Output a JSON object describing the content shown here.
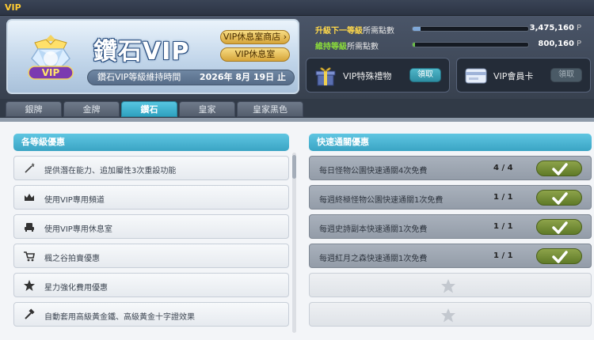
{
  "window": {
    "title": "VIP"
  },
  "vip_card": {
    "tier_name": "鑽石VIP",
    "emblem_text": "VIP",
    "shop_button": "VIP休息室商店",
    "lounge_button": "VIP休息室",
    "maintain_label": "鑽石VIP等級維持時間",
    "maintain_date": "2026年 8月 19日 止"
  },
  "progress": {
    "upgrade_key": "升級下一等級",
    "upgrade_rest": "所需點數",
    "upgrade_value": "3,475,160",
    "upgrade_fill_pct": 7,
    "maintain_key": "維持等級",
    "maintain_rest": "所需點數",
    "maintain_value": "800,160",
    "maintain_fill_pct": 2,
    "unit": "P"
  },
  "rewards": {
    "gift_label": "VIP特殊禮物",
    "gift_claim": "領取",
    "card_label": "VIP會員卡",
    "card_claim": "領取"
  },
  "tabs": [
    {
      "label": "銀牌"
    },
    {
      "label": "金牌"
    },
    {
      "label": "鑽石"
    },
    {
      "label": "皇家"
    },
    {
      "label": "皇家黑色"
    }
  ],
  "benefits": {
    "header": "各等級優惠",
    "items": [
      {
        "text": "提供潛在能力、追加屬性3次重設功能",
        "icon": "wand-icon"
      },
      {
        "text": "使用VIP專用頻道",
        "icon": "crown-icon"
      },
      {
        "text": "使用VIP專用休息室",
        "icon": "armchair-icon"
      },
      {
        "text": "楓之谷拍賣優惠",
        "icon": "cart-icon"
      },
      {
        "text": "星力強化費用優惠",
        "icon": "star-icon"
      },
      {
        "text": "自動套用高級黃金鐵、高級黃金十字證效果",
        "icon": "hammer-icon"
      }
    ]
  },
  "quick_pass": {
    "header": "快速通關優惠",
    "items": [
      {
        "text": "每日怪物公園快速通關4次免費",
        "count": "4 / 4"
      },
      {
        "text": "每週終極怪物公園快速通關1次免費",
        "count": "1 / 1"
      },
      {
        "text": "每週史詩副本快速通關1次免費",
        "count": "1 / 1"
      },
      {
        "text": "每週紅月之森快速通關1次免費",
        "count": "1 / 1"
      }
    ]
  },
  "colors": {
    "accent": "#3aa4c4",
    "gold": "#d6a53a",
    "check_green": "#6f8a34",
    "upgrade_key": "#ffd84a",
    "maintain_key": "#8bdc3a"
  }
}
